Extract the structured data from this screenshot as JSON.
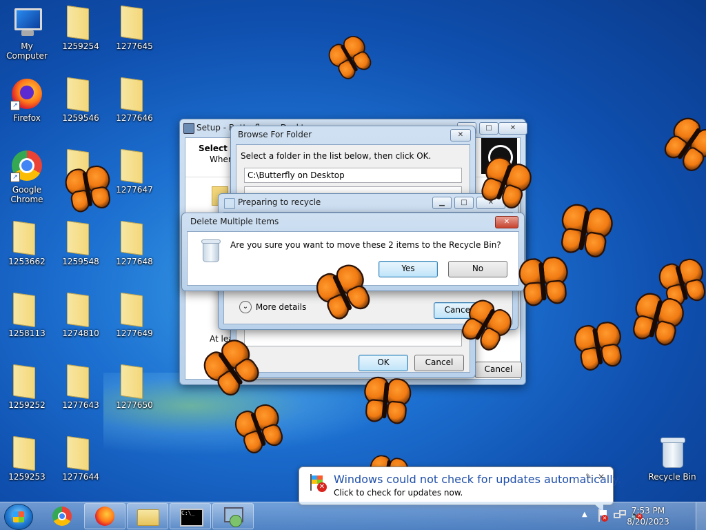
{
  "desktop": {
    "icons": [
      {
        "label": "My Computer"
      },
      {
        "label": "Firefox"
      },
      {
        "label": "Google Chrome"
      },
      {
        "label": "1253662"
      },
      {
        "label": "1258113"
      },
      {
        "label": "1259252"
      },
      {
        "label": "1259253"
      },
      {
        "label": "1259254"
      },
      {
        "label": "1259546"
      },
      {
        "label": "1259548"
      },
      {
        "label": "1274810"
      },
      {
        "label": "1277643"
      },
      {
        "label": "1277644"
      },
      {
        "label": "1277645"
      },
      {
        "label": "1277646"
      },
      {
        "label": "1277647"
      },
      {
        "label": "1277648"
      },
      {
        "label": "1277649"
      },
      {
        "label": "1277650"
      },
      {
        "label": "Recycle Bin"
      }
    ]
  },
  "setup_window": {
    "title": "Setup - Butterfly on Desktop",
    "heading": "Select D",
    "subheading": "Where",
    "at_least": "At leas",
    "cancel_label": "Cancel"
  },
  "browse_dialog": {
    "title": "Browse For Folder",
    "instruction": "Select a folder in the list below, then click OK.",
    "path": "C:\\Butterfly on Desktop",
    "ok_label": "OK",
    "cancel_label": "Cancel"
  },
  "recycle_dialog": {
    "title": "Preparing to recycle",
    "more_details": "More details",
    "cancel_label": "Cancel"
  },
  "delete_dialog": {
    "title": "Delete Multiple Items",
    "message": "Are you sure you want to move these 2 items to the Recycle Bin?",
    "yes_label": "Yes",
    "no_label": "No"
  },
  "notification": {
    "title": "Windows could not check for updates automatically.",
    "text": "Click to check for updates now."
  },
  "taskbar": {
    "time": "7:53 PM",
    "date": "8/20/2023"
  }
}
